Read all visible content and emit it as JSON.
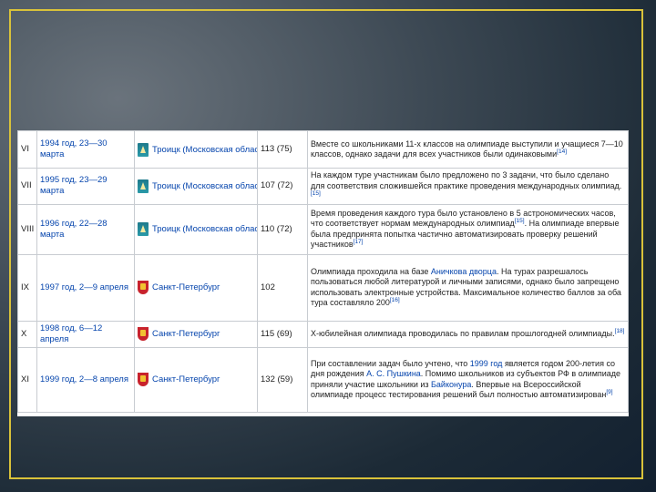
{
  "rows": [
    {
      "no": "VI",
      "date": "1994 год, 23—30 марта",
      "city": "Троицк (Московская область)",
      "flag": "troitsk-coat-of-arms-icon",
      "participants": "113 (75)",
      "desc_parts": [
        "Вместе со школьниками 11-х классов на олимпиаде выступили и учащиеся 7—10 классов, однако задачи для всех участников были одинаковыми"
      ],
      "sup": "[14]"
    },
    {
      "no": "VII",
      "date": "1995 год, 23—29 марта",
      "city": "Троицк (Московская область)",
      "flag": "troitsk-coat-of-arms-icon",
      "participants": "107 (72)",
      "desc_parts": [
        "На каждом туре участникам было предложено по 3 задачи, что было сделано для соответствия сложившейся практике проведения международных олимпиад."
      ],
      "sup": "[15]"
    },
    {
      "no": "VIII",
      "date": "1996 год, 22—28 марта",
      "city": "Троицк (Московская область)",
      "flag": "troitsk-coat-of-arms-icon",
      "participants": "110 (72)",
      "desc_parts": [
        "Время проведения каждого тура было установлено в 5 астрономических часов, что соответствует нормам международных олимпиад",
        ". На олимпиаде впервые была предпринята попытка частично автоматизировать проверку решений участников"
      ],
      "sup_mid": "[15]",
      "sup": "[17]"
    },
    {
      "no": "IX",
      "date": "1997 год, 2—9 апреля",
      "city": "Санкт-Петербург",
      "flag": "spb-coat-of-arms-icon",
      "participants": "102",
      "desc_pre": "Олимпиада проходила на базе ",
      "desc_link": "Аничкова дворца",
      "desc_post": ". На турах разрешалось пользоваться любой литературой и личными записями, однако было запрещено использовать электронные устройства. Максимальное количество баллов за оба тура составляло 200",
      "sup": "[16]"
    },
    {
      "no": "X",
      "date": "1998 год, 6—12 апреля",
      "city": "Санкт-Петербург",
      "flag": "spb-coat-of-arms-icon",
      "participants": "115 (69)",
      "desc_parts": [
        "X-юбилейная олимпиада проводилась по правилам прошлогодней олимпиады."
      ],
      "sup": "[18]"
    },
    {
      "no": "XI",
      "date": "1999 год, 2—8 апреля",
      "city": "Санкт-Петербург",
      "flag": "spb-coat-of-arms-icon",
      "participants": "132 (59)",
      "desc_a": "При составлении задач было учтено, что ",
      "desc_link1": "1999 год",
      "desc_b": " является годом 200-летия со дня рождения ",
      "desc_link2": "А. С. Пушкина",
      "desc_c": ". Помимо школьников из субъектов РФ в олимпиаде приняли участие школьники из ",
      "desc_link3": "Байконура",
      "desc_d": ". Впервые на Всероссийской олимпиаде процесс тестирования решений был полностью автоматизирован",
      "sup": "[9]"
    }
  ]
}
